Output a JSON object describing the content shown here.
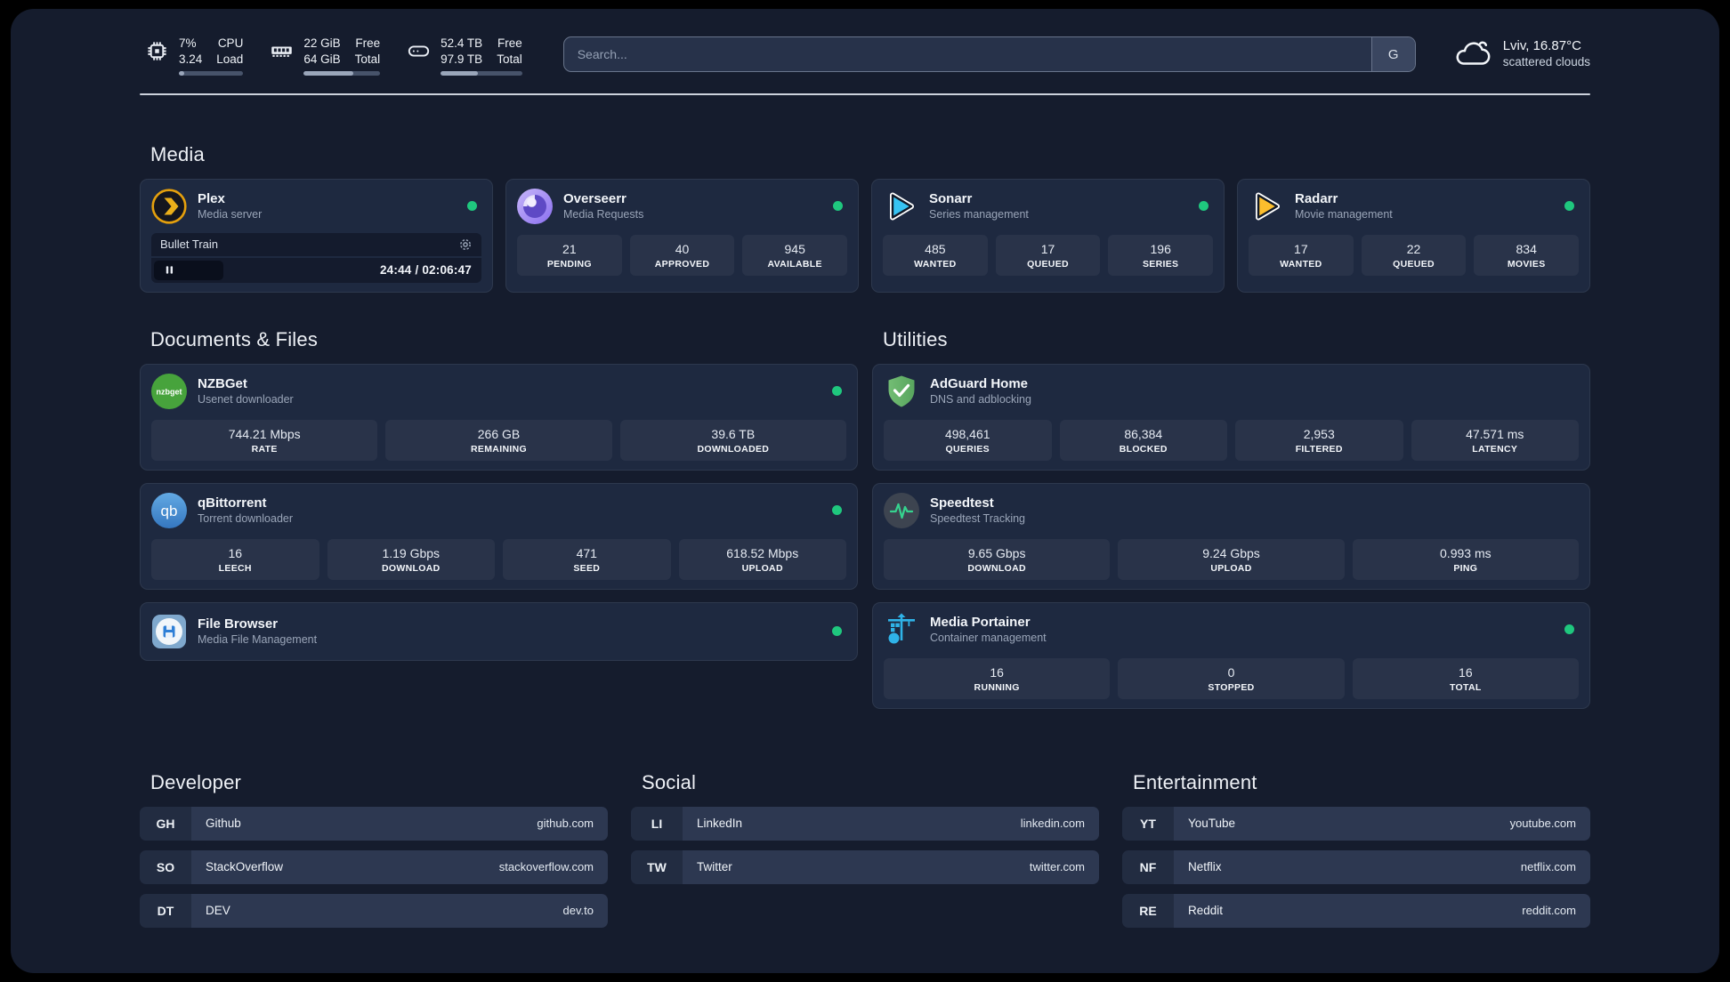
{
  "colors": {
    "accent_green": "#1fc77e",
    "plex_gold": "#e5a00d",
    "sonarr_blue": "#37c3f2",
    "radarr_amber": "#fcbe2d",
    "nzbget_green": "#47a33c",
    "qbittorrent_blue": "#3577c0",
    "adguard_green": "#5fae63",
    "speedtest_green": "#36d28e",
    "portainer_blue": "#2fb3e8",
    "filebrowser_blue": "#2f7fd6"
  },
  "header": {
    "resources": [
      {
        "icon": "cpu-icon",
        "value_top": "7%",
        "value_bottom": "3.24",
        "label_top": "CPU",
        "label_bottom": "Load",
        "percent": 8
      },
      {
        "icon": "memory-icon",
        "value_top": "22 GiB",
        "value_bottom": "64 GiB",
        "label_top": "Free",
        "label_bottom": "Total",
        "percent": 65
      },
      {
        "icon": "disk-icon",
        "value_top": "52.4 TB",
        "value_bottom": "97.9 TB",
        "label_top": "Free",
        "label_bottom": "Total",
        "percent": 46
      }
    ],
    "search": {
      "placeholder": "Search...",
      "provider_label": "G"
    },
    "weather": {
      "location_temp": "Lviv, 16.87°C",
      "condition": "scattered clouds",
      "icon": "cloud-icon"
    }
  },
  "sections": {
    "media": {
      "title": "Media",
      "apps": [
        {
          "name": "Plex",
          "desc": "Media server",
          "icon": "plex-icon",
          "online": true,
          "player": {
            "title": "Bullet Train",
            "time": "24:44 / 02:06:47"
          }
        },
        {
          "name": "Overseerr",
          "desc": "Media Requests",
          "icon": "overseerr-icon",
          "online": true,
          "stats": [
            {
              "value": "21",
              "label": "PENDING"
            },
            {
              "value": "40",
              "label": "APPROVED"
            },
            {
              "value": "945",
              "label": "AVAILABLE"
            }
          ]
        },
        {
          "name": "Sonarr",
          "desc": "Series management",
          "icon": "sonarr-icon",
          "online": true,
          "stats": [
            {
              "value": "485",
              "label": "WANTED"
            },
            {
              "value": "17",
              "label": "QUEUED"
            },
            {
              "value": "196",
              "label": "SERIES"
            }
          ]
        },
        {
          "name": "Radarr",
          "desc": "Movie management",
          "icon": "radarr-icon",
          "online": true,
          "stats": [
            {
              "value": "17",
              "label": "WANTED"
            },
            {
              "value": "22",
              "label": "QUEUED"
            },
            {
              "value": "834",
              "label": "MOVIES"
            }
          ]
        }
      ]
    },
    "documents": {
      "title": "Documents & Files",
      "apps": [
        {
          "name": "NZBGet",
          "desc": "Usenet downloader",
          "icon": "nzbget-icon",
          "online": true,
          "stats": [
            {
              "value": "744.21 Mbps",
              "label": "RATE"
            },
            {
              "value": "266 GB",
              "label": "REMAINING"
            },
            {
              "value": "39.6 TB",
              "label": "DOWNLOADED"
            }
          ]
        },
        {
          "name": "qBittorrent",
          "desc": "Torrent downloader",
          "icon": "qbittorrent-icon",
          "online": true,
          "stats": [
            {
              "value": "16",
              "label": "LEECH"
            },
            {
              "value": "1.19 Gbps",
              "label": "DOWNLOAD"
            },
            {
              "value": "471",
              "label": "SEED"
            },
            {
              "value": "618.52 Mbps",
              "label": "UPLOAD"
            }
          ]
        },
        {
          "name": "File Browser",
          "desc": "Media File Management",
          "icon": "filebrowser-icon",
          "online": true,
          "stats": []
        }
      ]
    },
    "utilities": {
      "title": "Utilities",
      "apps": [
        {
          "name": "AdGuard Home",
          "desc": "DNS and adblocking",
          "icon": "adguard-icon",
          "online": false,
          "stats": [
            {
              "value": "498,461",
              "label": "QUERIES"
            },
            {
              "value": "86,384",
              "label": "BLOCKED"
            },
            {
              "value": "2,953",
              "label": "FILTERED"
            },
            {
              "value": "47.571 ms",
              "label": "LATENCY"
            }
          ]
        },
        {
          "name": "Speedtest",
          "desc": "Speedtest Tracking",
          "icon": "speedtest-icon",
          "online": false,
          "stats": [
            {
              "value": "9.65 Gbps",
              "label": "DOWNLOAD"
            },
            {
              "value": "9.24 Gbps",
              "label": "UPLOAD"
            },
            {
              "value": "0.993 ms",
              "label": "PING"
            }
          ]
        },
        {
          "name": "Media Portainer",
          "desc": "Container management",
          "icon": "portainer-icon",
          "online": true,
          "stats": [
            {
              "value": "16",
              "label": "RUNNING"
            },
            {
              "value": "0",
              "label": "STOPPED"
            },
            {
              "value": "16",
              "label": "TOTAL"
            }
          ]
        }
      ]
    }
  },
  "bookmarks": [
    {
      "title": "Developer",
      "links": [
        {
          "abbr": "GH",
          "name": "Github",
          "url": "github.com"
        },
        {
          "abbr": "SO",
          "name": "StackOverflow",
          "url": "stackoverflow.com"
        },
        {
          "abbr": "DT",
          "name": "DEV",
          "url": "dev.to"
        }
      ]
    },
    {
      "title": "Social",
      "links": [
        {
          "abbr": "LI",
          "name": "LinkedIn",
          "url": "linkedin.com"
        },
        {
          "abbr": "TW",
          "name": "Twitter",
          "url": "twitter.com"
        }
      ]
    },
    {
      "title": "Entertainment",
      "links": [
        {
          "abbr": "YT",
          "name": "YouTube",
          "url": "youtube.com"
        },
        {
          "abbr": "NF",
          "name": "Netflix",
          "url": "netflix.com"
        },
        {
          "abbr": "RE",
          "name": "Reddit",
          "url": "reddit.com"
        }
      ]
    }
  ]
}
